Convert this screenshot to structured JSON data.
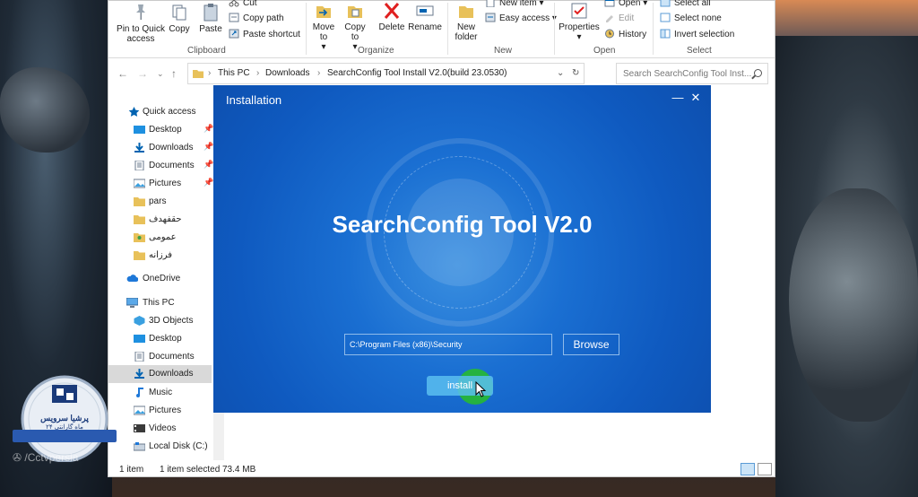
{
  "ribbon": {
    "pin_to_quick_access": "Pin to Quick access",
    "copy": "Copy",
    "paste": "Paste",
    "cut": "Cut",
    "copy_path": "Copy path",
    "paste_shortcut": "Paste shortcut",
    "move_to": "Move to",
    "copy_to": "Copy to",
    "delete": "Delete",
    "rename": "Rename",
    "new_folder": "New folder",
    "new_item": "New item",
    "easy_access": "Easy access",
    "properties": "Properties",
    "open": "Open",
    "edit": "Edit",
    "history": "History",
    "select_all": "Select all",
    "select_none": "Select none",
    "invert_selection": "Invert selection",
    "groups": {
      "clipboard": "Clipboard",
      "organize": "Organize",
      "new": "New",
      "open": "Open",
      "select": "Select"
    }
  },
  "address": {
    "crumbs": [
      "This PC",
      "Downloads",
      "SearchConfig Tool Install V2.0(build 23.0530)"
    ],
    "search_placeholder": "Search SearchConfig Tool Inst..."
  },
  "nav": {
    "items": [
      {
        "label": "Quick access"
      },
      {
        "label": "Desktop"
      },
      {
        "label": "Downloads"
      },
      {
        "label": "Documents"
      },
      {
        "label": "Pictures"
      },
      {
        "label": "pars"
      },
      {
        "label": "حقفهدف"
      },
      {
        "label": "عمومی"
      },
      {
        "label": "فرزانه"
      },
      {
        "label": "OneDrive"
      },
      {
        "label": "This PC"
      },
      {
        "label": "3D Objects"
      },
      {
        "label": "Desktop"
      },
      {
        "label": "Documents"
      },
      {
        "label": "Downloads"
      },
      {
        "label": "Music"
      },
      {
        "label": "Pictures"
      },
      {
        "label": "Videos"
      },
      {
        "label": "Local Disk (C:)"
      }
    ]
  },
  "status": {
    "count": "1 item",
    "selected": "1 item selected",
    "size": "73.4 MB"
  },
  "installer": {
    "title": "Installation",
    "minimize": "—",
    "close": "✕",
    "headline": "SearchConfig Tool V2.0",
    "path": "C:\\Program Files (x86)\\Security",
    "browse": "Browse",
    "install": "install"
  },
  "watermark": {
    "brand": "پرشیا سرویس",
    "warranty": "۲۴ ماه گارانتی",
    "handle": "/Cctvpersia"
  },
  "colors": {
    "installer_blue": "#1a6fd2",
    "install_highlight": "#28be28",
    "explorer_accent": "#0063b1"
  }
}
